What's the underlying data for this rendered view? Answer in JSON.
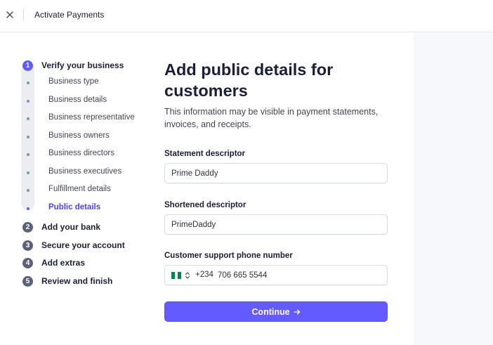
{
  "topbar": {
    "title": "Activate Payments",
    "close_icon": "close-icon"
  },
  "steps": [
    {
      "num": "1",
      "label": "Verify your business",
      "state": "active",
      "substeps": [
        {
          "label": "Business type"
        },
        {
          "label": "Business details"
        },
        {
          "label": "Business representative"
        },
        {
          "label": "Business owners"
        },
        {
          "label": "Business directors"
        },
        {
          "label": "Business executives"
        },
        {
          "label": "Fulfillment details"
        },
        {
          "label": "Public details",
          "active": true
        }
      ]
    },
    {
      "num": "2",
      "label": "Add your bank"
    },
    {
      "num": "3",
      "label": "Secure your account"
    },
    {
      "num": "4",
      "label": "Add extras"
    },
    {
      "num": "5",
      "label": "Review and finish"
    }
  ],
  "form": {
    "heading": "Add public details for customers",
    "description": "This information may be visible in payment statements, invoices, and receipts.",
    "statement_descriptor": {
      "label": "Statement descriptor",
      "value": "Prime Daddy"
    },
    "shortened_descriptor": {
      "label": "Shortened descriptor",
      "value": "PrimeDaddy"
    },
    "support_phone": {
      "label": "Customer support phone number",
      "country_flag": "nigeria-flag-icon",
      "dial_code": "+234",
      "value": "706 665 5544"
    },
    "continue_label": "Continue",
    "continue_icon": "arrow-right-icon"
  },
  "colors": {
    "accent": "#635bff",
    "rail": "#ebeef1",
    "panel": "#f6f8fa",
    "flag_green": "#008751"
  }
}
